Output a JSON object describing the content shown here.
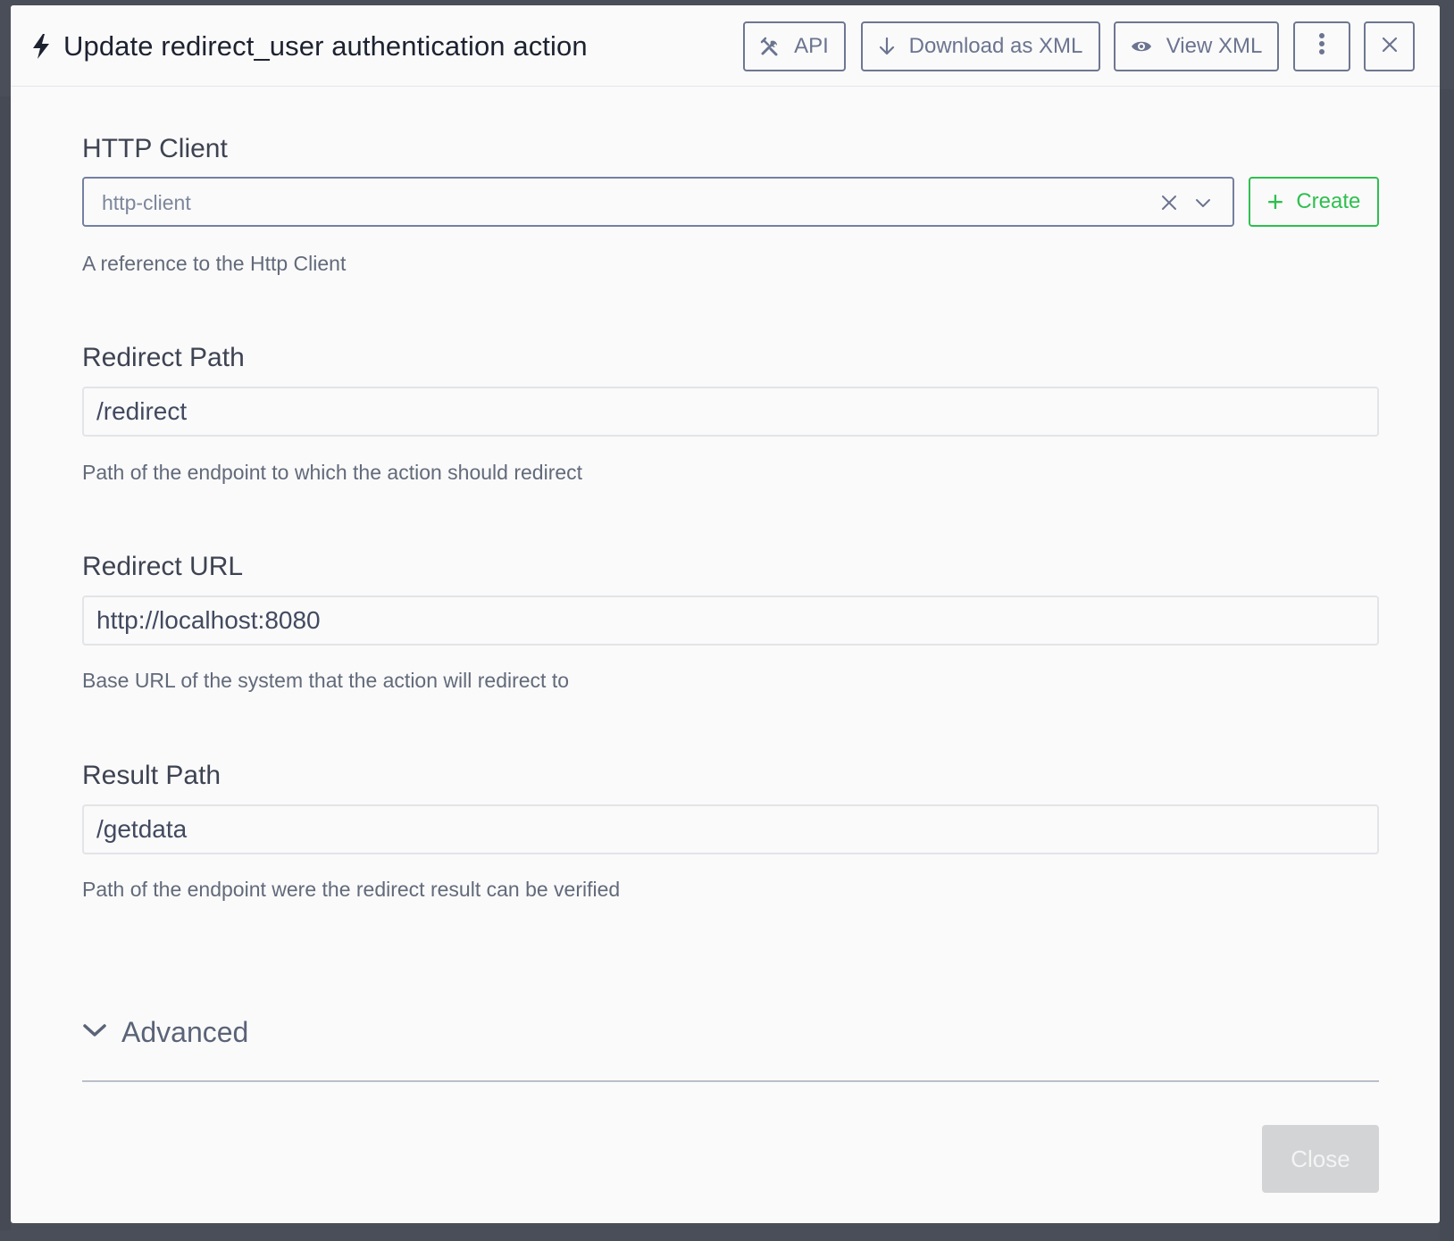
{
  "modal": {
    "title": "Update redirect_user authentication action",
    "title_icon": "bolt-icon",
    "header_buttons": {
      "api": {
        "label": "API",
        "icon": "tools-icon"
      },
      "download": {
        "label": "Download as XML",
        "icon": "arrow-down-icon"
      },
      "view": {
        "label": "View XML",
        "icon": "eye-icon"
      },
      "more": {
        "icon": "kebab-menu-icon"
      },
      "close": {
        "icon": "close-icon"
      }
    }
  },
  "form": {
    "http_client": {
      "label": "HTTP Client",
      "value": "http-client",
      "help": "A reference to the Http Client",
      "create_label": "Create"
    },
    "redirect_path": {
      "label": "Redirect Path",
      "value": "/redirect",
      "help": "Path of the endpoint to which the action should redirect"
    },
    "redirect_url": {
      "label": "Redirect URL",
      "value": "http://localhost:8080",
      "help": "Base URL of the system that the action will redirect to"
    },
    "result_path": {
      "label": "Result Path",
      "value": "/getdata",
      "help": "Path of the endpoint were the redirect result can be verified"
    },
    "advanced": {
      "label": "Advanced"
    }
  },
  "footer": {
    "close_label": "Close"
  },
  "colors": {
    "accent_green": "#2fbf4f",
    "border_gray": "#6e7791",
    "disabled_button": "#d3d4d6"
  }
}
